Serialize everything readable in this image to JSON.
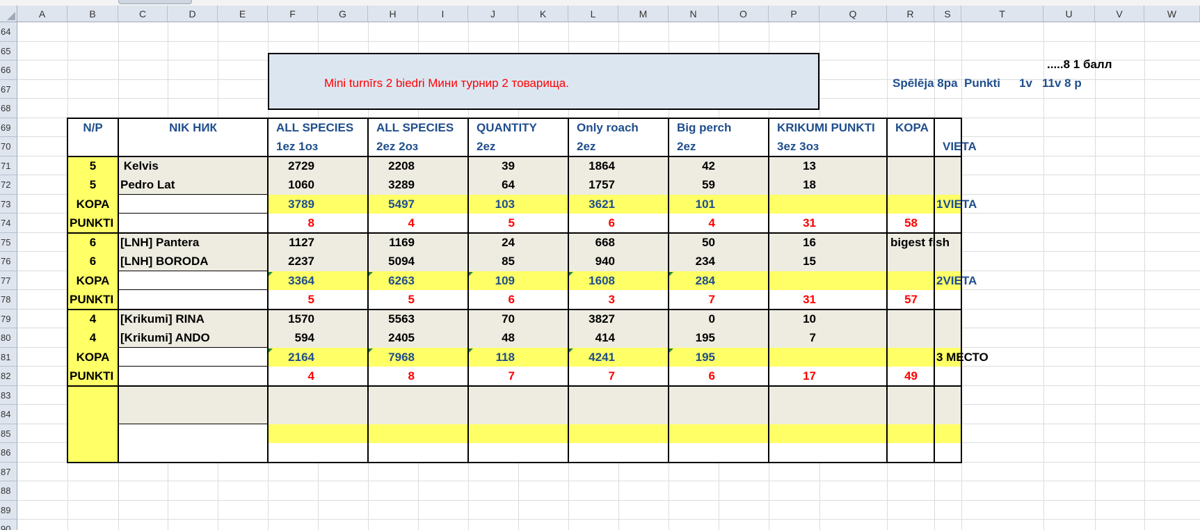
{
  "sheet": {
    "columns": [
      "A",
      "B",
      "C",
      "D",
      "E",
      "F",
      "G",
      "H",
      "I",
      "J",
      "K",
      "L",
      "M",
      "N",
      "O",
      "P",
      "Q",
      "R",
      "S",
      "T",
      "U",
      "V",
      "W"
    ],
    "rows": [
      "64",
      "65",
      "66",
      "67",
      "68",
      "69",
      "70",
      "71",
      "72",
      "73",
      "74",
      "75",
      "76",
      "77",
      "78",
      "79",
      "80",
      "81",
      "82",
      "83",
      "84",
      "85",
      "86",
      "87",
      "88",
      "89",
      "90"
    ]
  },
  "title": "Mini turnīrs 2 biedri  Мини турнир 2 товарища.",
  "side_notes": {
    "r66": ".....8 1 балл",
    "r67a": "Spēlēja  8pa",
    "r67b": "Punkti",
    "r67c": "1v",
    "r67d": "11v 8 p"
  },
  "headers": {
    "np": "N/P",
    "nik": "NIK НИК",
    "all1": "ALL SPECIES",
    "all1_sub": "1ez   1оз",
    "all2": "ALL SPECIES",
    "all2_sub": "2ez 2оз",
    "qty": "QUANTITY",
    "qty_sub": "2ez",
    "roach": "Only roach",
    "roach_sub": "2ez",
    "perch": "Big perch",
    "perch_sub": "2ez",
    "krik": "KRIKUMI PUNKTI",
    "krik_sub": "3ez 3оз",
    "kopa": "KOPA",
    "vieta": "VIETA"
  },
  "groups": [
    {
      "players": [
        {
          "np": "5",
          "name": " Kelvis",
          "all1": "2729",
          "all2": "2208",
          "qty": "39",
          "roach": "1864",
          "perch": "42",
          "krik": "13"
        },
        {
          "np": "5",
          "name": "Pedro Lat",
          "all1": "1060",
          "all2": "3289",
          "qty": "64",
          "roach": "1757",
          "perch": "59",
          "krik": "18"
        }
      ],
      "kopa": {
        "label": "KOPA",
        "all1": "3789",
        "all2": "5497",
        "qty": "103",
        "roach": "3621",
        "perch": "101",
        "vieta": "1VIETA"
      },
      "punkti": {
        "label": "PUNKTI",
        "all1": "8",
        "all2": "4",
        "qty": "5",
        "roach": "6",
        "perch": "4",
        "krik": "31",
        "kopa": "58"
      },
      "note": ""
    },
    {
      "players": [
        {
          "np": "6",
          "name": "[LNH] Pantera",
          "all1": "1127",
          "all2": "1169",
          "qty": "24",
          "roach": "668",
          "perch": "50",
          "krik": "16"
        },
        {
          "np": "6",
          "name": "[LNH] BORODA",
          "all1": "2237",
          "all2": "5094",
          "qty": "85",
          "roach": "940",
          "perch": "234",
          "krik": "15"
        }
      ],
      "kopa": {
        "label": "KOPA",
        "all1": "3364",
        "all2": "6263",
        "qty": "109",
        "roach": "1608",
        "perch": "284",
        "vieta": "2VIETA"
      },
      "punkti": {
        "label": "PUNKTI",
        "all1": "5",
        "all2": "5",
        "qty": "6",
        "roach": "3",
        "perch": "7",
        "krik": "31",
        "kopa": "57"
      },
      "note": "bigest fish"
    },
    {
      "players": [
        {
          "np": "4",
          "name": "[Krikumi] RINA",
          "all1": "1570",
          "all2": "5563",
          "qty": "70",
          "roach": "3827",
          "perch": "0",
          "krik": "10"
        },
        {
          "np": "4",
          "name": "[Krikumi] ANDO",
          "all1": "594",
          "all2": "2405",
          "qty": "48",
          "roach": "414",
          "perch": "195",
          "krik": "7"
        }
      ],
      "kopa": {
        "label": "KOPA",
        "all1": "2164",
        "all2": "7968",
        "qty": "118",
        "roach": "4241",
        "perch": "195",
        "vieta": "3 МЕСТО"
      },
      "punkti": {
        "label": "PUNKTI",
        "all1": "4",
        "all2": "8",
        "qty": "7",
        "roach": "7",
        "perch": "6",
        "krik": "17",
        "kopa": "49"
      },
      "note": ""
    }
  ],
  "colors": {
    "yellow": "#ffff66",
    "beige": "#eeece1",
    "banner": "#dce6f1",
    "blue_text": "#1f4e8c",
    "red_text": "#ff0000"
  }
}
